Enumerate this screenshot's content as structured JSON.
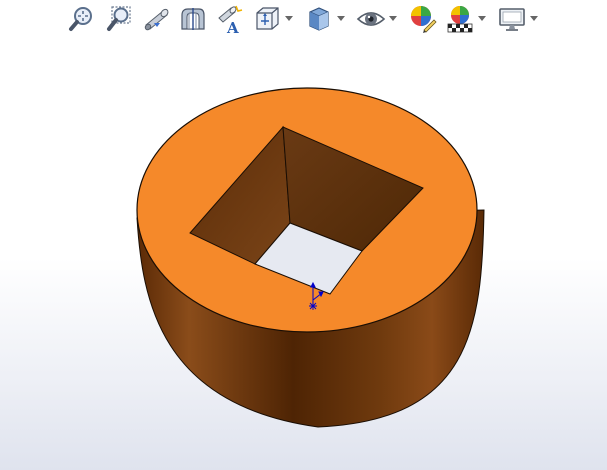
{
  "toolbar": {
    "buttons": [
      {
        "name": "zoom-to-fit-button",
        "icon": "zoom-to-fit-icon",
        "dropdown": false
      },
      {
        "name": "zoom-to-area-button",
        "icon": "zoom-to-area-icon",
        "dropdown": false
      },
      {
        "name": "previous-view-button",
        "icon": "previous-view-icon",
        "dropdown": false
      },
      {
        "name": "section-view-button",
        "icon": "section-view-icon",
        "dropdown": false
      },
      {
        "name": "dynamic-annotation-views-button",
        "icon": "dynamic-annotation-icon",
        "dropdown": false
      },
      {
        "name": "view-orientation-button",
        "icon": "view-orientation-icon",
        "dropdown": true
      },
      {
        "name": "display-style-button",
        "icon": "display-style-icon",
        "dropdown": true
      },
      {
        "name": "hide-show-items-button",
        "icon": "eye-icon",
        "dropdown": true
      },
      {
        "name": "edit-appearance-button",
        "icon": "edit-appearance-icon",
        "dropdown": false
      },
      {
        "name": "apply-scene-button",
        "icon": "apply-scene-icon",
        "dropdown": true
      },
      {
        "name": "view-settings-button",
        "icon": "monitor-icon",
        "dropdown": true
      }
    ]
  },
  "model": {
    "face_color": "#f5892a",
    "side_dark": "#4a2304",
    "side_mid": "#6f3a0c",
    "side_light": "#8a4a18",
    "hole_wall_dark": "#5a2d08",
    "hole_wall_light": "#7a4418",
    "triad_color": "#0000cc"
  }
}
